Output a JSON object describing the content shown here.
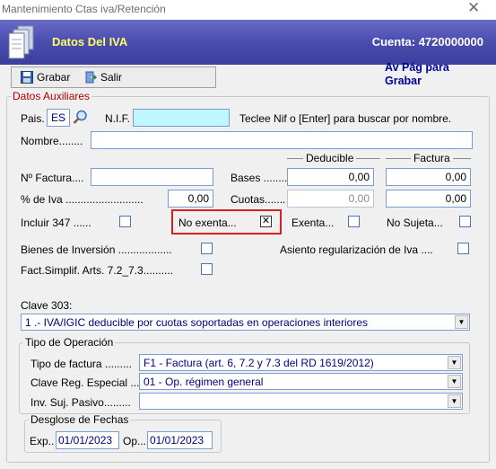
{
  "window": {
    "title": "Mantenimiento Ctas iva/Retención",
    "close_glyph": "✕"
  },
  "header": {
    "title": "Datos Del IVA",
    "account": "Cuenta: 4720000000"
  },
  "toolbar": {
    "grabar": "Grabar",
    "salir": "Salir"
  },
  "hint": "Av Pág para Grabar",
  "aux": {
    "legend": "Datos Auxiliares",
    "pais_label": "Pais.",
    "pais_value": "ES",
    "nif_label": "N.I.F.",
    "nif_value": "",
    "search_hint": "Teclee Nif o [Enter] para buscar por nombre.",
    "nombre_label": "Nombre........",
    "nombre_value": "",
    "deducible_label": "Deducible",
    "factura_label": "Factura",
    "nfactura_label": "Nº Factura....",
    "nfactura_value": "",
    "bases_label": "Bases ........",
    "bases_deducible": "0,00",
    "bases_factura": "0,00",
    "piva_label": "% de Iva ..........................",
    "piva_value": "0,00",
    "cuotas_label": "Cuotas.......",
    "cuotas_deducible": "0,00",
    "cuotas_factura": "0,00",
    "incluir_label": "Incluir 347 ......",
    "no_exenta_label": "No exenta...",
    "no_exenta_mark": "✕",
    "exenta_label": "Exenta...",
    "no_sujeta_label": "No Sujeta...",
    "bienes_label": "Bienes de Inversión ..................",
    "asiento_label": "Asiento regularización de Iva ....",
    "fact_label": "Fact.Simplif. Arts. 7.2_7.3.........."
  },
  "clave303": {
    "label": "Clave 303:",
    "value": "1 .- IVA/IGIC deducible por cuotas soportadas en operaciones interiores"
  },
  "tipo_op": {
    "legend": "Tipo de Operación",
    "tipo_factura_label": "Tipo de factura .........",
    "tipo_factura_value": "F1 - Factura (art. 6, 7.2 y 7.3 del RD 1619/2012)",
    "clave_reg_label": "Clave Reg. Especial ....",
    "clave_reg_value": "01 - Op. régimen general",
    "inv_label": "Inv. Suj. Pasivo.........",
    "inv_value": ""
  },
  "fechas": {
    "legend": "Desglose de Fechas",
    "exp_label": "Exp..",
    "exp_value": "01/01/2023",
    "op_label": "Op...",
    "op_value": "01/01/2023"
  },
  "colors": {
    "header_bg": "#4c4fb0",
    "header_title": "#ffff66",
    "hint": "#000099",
    "highlight": "#d92020",
    "nif_bg": "#bff7ff"
  }
}
